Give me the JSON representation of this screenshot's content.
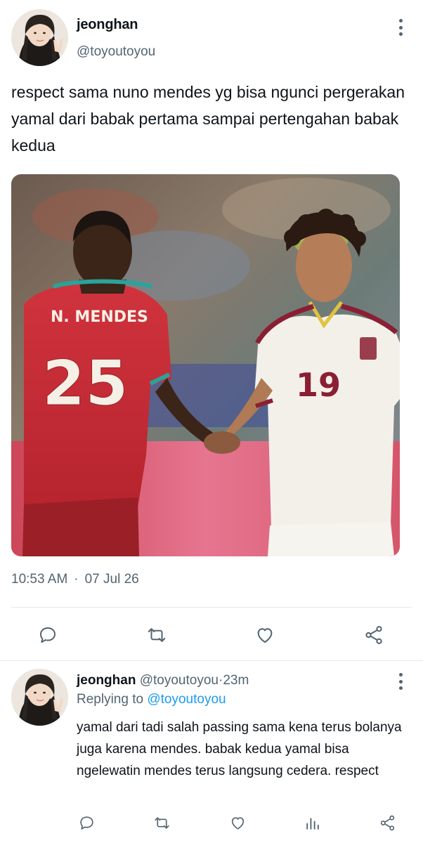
{
  "post": {
    "author_name": "jeonghan",
    "author_handle": "@toyoutoyou",
    "text": "respect sama nuno mendes yg bisa ngunci pergerakan yamal dari babak pertama sampai pertengahan babak kedua",
    "time": "10:53 AM",
    "separator": "·",
    "date": "07 Jul 26",
    "media": {
      "left_player_name": "N. MENDES",
      "left_player_number": "25",
      "right_player_number": "19"
    }
  },
  "actions": [
    "reply-icon",
    "retweet-icon",
    "like-icon",
    "share-icon"
  ],
  "reply": {
    "author_name": "jeonghan",
    "author_handle": "@toyoutoyou",
    "separator": "·",
    "time": "23m",
    "replying_label": "Replying to",
    "replying_handle": "@toyoutoyou",
    "text": "yamal dari tadi salah passing sama kena terus bolanya juga karena mendes. babak kedua yamal bisa ngelewatin mendes terus langsung cedera. respect"
  },
  "reply_actions": [
    "reply-icon",
    "retweet-icon",
    "like-icon",
    "views-icon",
    "share-icon"
  ],
  "colors": {
    "text": "#0f1419",
    "secondary": "#536471",
    "link": "#1d9bf0",
    "divider": "#e4e8eb"
  }
}
